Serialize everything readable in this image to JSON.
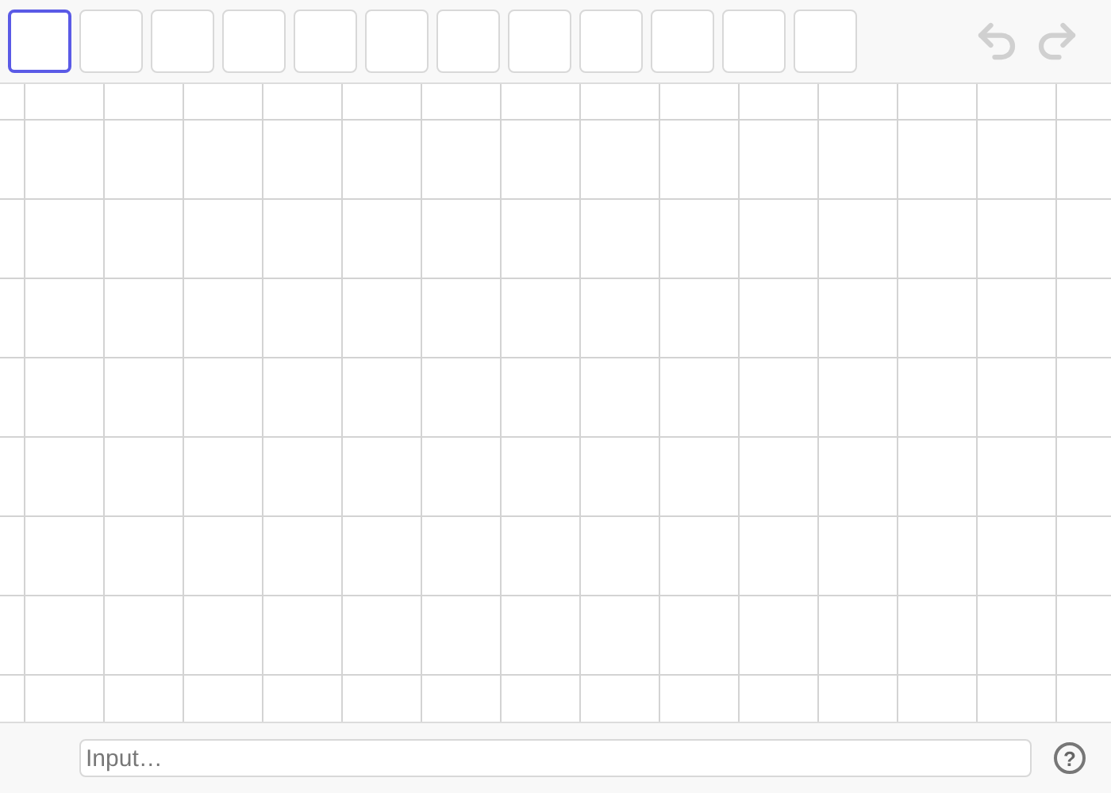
{
  "toolbar": {
    "tools": [
      {
        "selected": true
      },
      {
        "selected": false
      },
      {
        "selected": false
      },
      {
        "selected": false
      },
      {
        "selected": false
      },
      {
        "selected": false
      },
      {
        "selected": false
      },
      {
        "selected": false
      },
      {
        "selected": false
      },
      {
        "selected": false
      },
      {
        "selected": false
      },
      {
        "selected": false
      }
    ],
    "undo": {
      "disabled": true
    },
    "redo": {
      "disabled": true
    }
  },
  "input_bar": {
    "placeholder": "Input…",
    "help": "?"
  }
}
